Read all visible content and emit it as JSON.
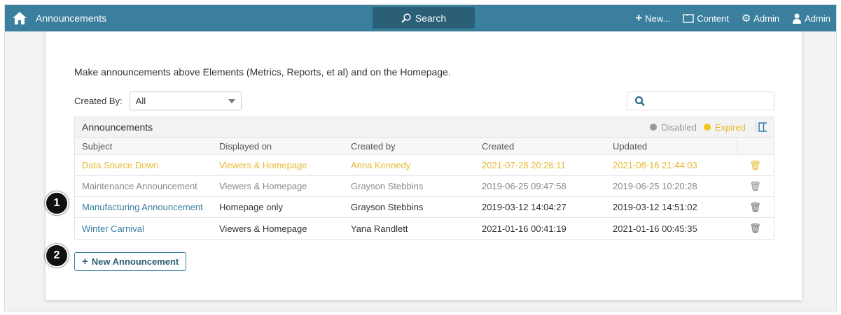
{
  "header": {
    "title": "Announcements",
    "search": "Search",
    "new": "New...",
    "content": "Content",
    "admin_settings": "Admin",
    "user": "Admin"
  },
  "intro": "Make announcements above Elements (Metrics, Reports, et al) and on the Homepage.",
  "filter": {
    "label": "Created By:",
    "value": "All"
  },
  "table": {
    "title": "Announcements",
    "legend": {
      "disabled": "Disabled",
      "expired": "Expired"
    },
    "columns": [
      "Subject",
      "Displayed on",
      "Created by",
      "Created",
      "Updated"
    ],
    "rows": [
      {
        "status": "expired",
        "cells": [
          "Data Source Down",
          "Viewers & Homepage",
          "Anna Kennedy",
          "2021-07-28 20:26:11",
          "2021-08-16 21:44:03"
        ]
      },
      {
        "status": "disabled",
        "cells": [
          "Maintenance Announcement",
          "Viewers & Homepage",
          "Grayson Stebbins",
          "2019-06-25 09:47:58",
          "2019-06-25 10:20:28"
        ]
      },
      {
        "status": "active",
        "cells": [
          "Manufacturing Announcement",
          "Homepage only",
          "Grayson Stebbins",
          "2019-03-12 14:04:27",
          "2019-03-12 14:51:02"
        ]
      },
      {
        "status": "active",
        "cells": [
          "Winter Carnival",
          "Viewers & Homepage",
          "Yana Randlett",
          "2021-01-16 00:41:19",
          "2021-01-16 00:45:35"
        ]
      }
    ]
  },
  "new_button": "New Announcement",
  "badges": [
    "1",
    "2"
  ],
  "colors": {
    "brand": "#3a7f9e",
    "expired": "#e8b830",
    "disabled": "#888888"
  }
}
